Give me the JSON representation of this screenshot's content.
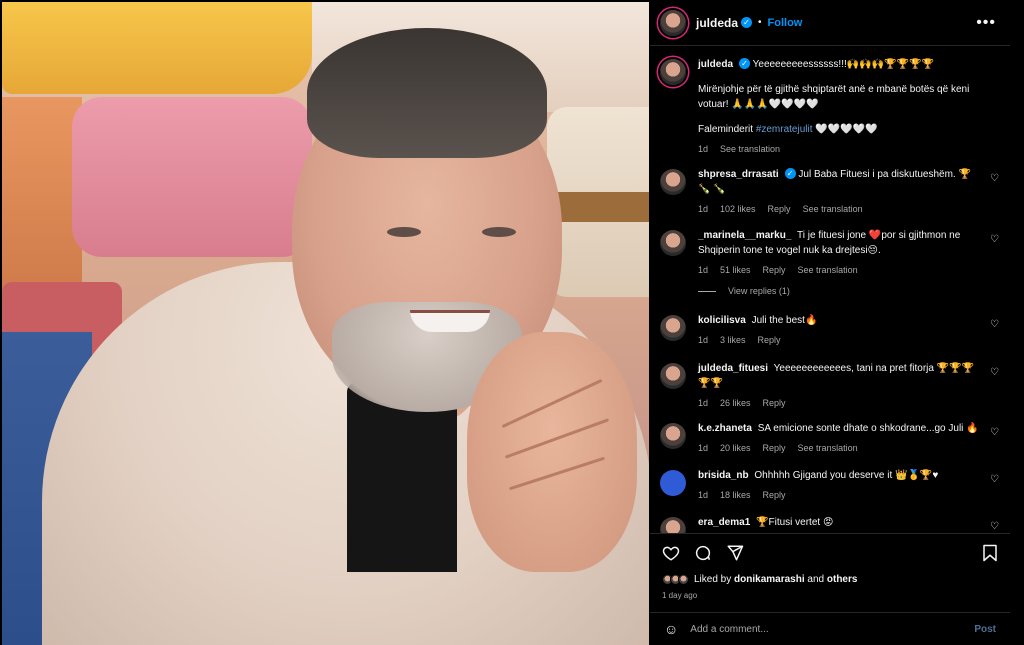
{
  "post": {
    "username": "juldeda",
    "follow_label": "Follow",
    "more_icon": "more-horizontal-icon"
  },
  "caption": {
    "username": "juldeda",
    "line1": "Yeeeeeeeeessssss!!!🙌🙌🙌🏆🏆🏆🏆",
    "line2": "Mirënjohje për të gjithë shqiptarët anë e mbanë botës që keni votuar! 🙏🙏🙏🤍🤍🤍🤍",
    "line3_prefix": "Faleminderit ",
    "hashtag": "#zemratejulit",
    "line3_suffix": " 🤍🤍🤍🤍🤍",
    "time": "1d",
    "see_translation": "See translation"
  },
  "comments": [
    {
      "username": "shpresa_drrasati",
      "verified": true,
      "text": "Jul Baba Fituesi i pa diskutueshëm. 🏆🍾 🍾",
      "time": "1d",
      "likes": "102 likes",
      "reply": "Reply",
      "translate": "See translation"
    },
    {
      "username": "_marinela__marku_",
      "verified": false,
      "text": "Ti je fituesi jone ❤️por si gjithmon ne Shqiperin tone te vogel nuk ka drejtesi😔.",
      "time": "1d",
      "likes": "51 likes",
      "reply": "Reply",
      "translate": "See translation"
    },
    {
      "username": "kolicilisva",
      "verified": false,
      "text": "Juli the best🔥",
      "time": "1d",
      "likes": "3 likes",
      "reply": "Reply",
      "translate": ""
    },
    {
      "username": "juldeda_fituesi",
      "verified": false,
      "text": "Yeeeeeeeeeeees, tani na pret fitorja 🏆🏆🏆 🏆🏆",
      "time": "1d",
      "likes": "26 likes",
      "reply": "Reply",
      "translate": ""
    },
    {
      "username": "k.e.zhaneta",
      "verified": false,
      "text": "SA emicione sonte dhate o shkodrane...go Juli 🔥",
      "time": "1d",
      "likes": "20 likes",
      "reply": "Reply",
      "translate": "See translation"
    },
    {
      "username": "brisida_nb",
      "verified": false,
      "text": "Ohhhhh Gjigand you deserve it 👑🥇🏆♥",
      "time": "1d",
      "likes": "18 likes",
      "reply": "Reply",
      "translate": ""
    },
    {
      "username": "era_dema1",
      "verified": false,
      "text": "🏆Fitusi vertet 😡",
      "time": "",
      "likes": "",
      "reply": "",
      "translate": ""
    }
  ],
  "view_replies": "View replies (1)",
  "liked_by": {
    "prefix": "Liked by ",
    "user": "donikamarashi",
    "suffix": " and ",
    "others": "others"
  },
  "posted_ago": "1 day ago",
  "add_comment": {
    "placeholder": "Add a comment...",
    "post_label": "Post"
  },
  "colors": {
    "accent": "#0095f6",
    "background": "#000000",
    "muted": "#a8a8a8"
  }
}
